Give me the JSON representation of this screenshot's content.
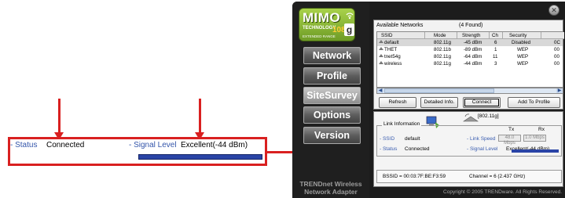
{
  "callout": {
    "status_label": "- Status",
    "status_value": "Connected",
    "signal_label": "- Signal Level",
    "signal_value": "Excellent(-44 dBm)",
    "signal_bar_fill": 1.0
  },
  "sidebar": {
    "logo_brand": "MIMO",
    "logo_sub": "TECHNOLOGY",
    "logo_range": "EXTENDED RANGE",
    "logo_speed": "108",
    "logo_band": "g",
    "items": [
      {
        "label": "Network"
      },
      {
        "label": "Profile"
      },
      {
        "label": "SiteSurvey"
      },
      {
        "label": "Options"
      },
      {
        "label": "Version"
      }
    ],
    "footer_line1": "TRENDnet Wireless",
    "footer_line2": "Network Adapter"
  },
  "survey": {
    "title": "Available Networks",
    "count": "(4 Found)",
    "columns": [
      "SSID",
      "Mode",
      "Strength",
      "Ch",
      "Security",
      ""
    ],
    "rows": [
      {
        "ssid": "default",
        "mode": "802.11g",
        "strength": "-45 dBm",
        "ch": "6",
        "security": "Disabled",
        "extra": "0C"
      },
      {
        "ssid": "THET",
        "mode": "802.11b",
        "strength": "-89 dBm",
        "ch": "1",
        "security": "WEP",
        "extra": "00"
      },
      {
        "ssid": "tnet54g",
        "mode": "802.11g",
        "strength": "-64 dBm",
        "ch": "11",
        "security": "WEP",
        "extra": "00"
      },
      {
        "ssid": "wireless",
        "mode": "802.11g",
        "strength": "-44 dBm",
        "ch": "3",
        "security": "WEP",
        "extra": "00"
      }
    ],
    "buttons": {
      "refresh": "Refresh",
      "detailed": "Detailed Info.",
      "connect": "Connect",
      "add_profile": "Add To Profile"
    }
  },
  "link_info": {
    "mode_badge": "[802.11g]",
    "title": "Link Information",
    "ssid_label": "- SSID",
    "ssid_value": "default",
    "status_label": "- Status",
    "status_value": "Connected",
    "link_speed_label": "- Link Speed",
    "tx_header": "Tx",
    "rx_header": "Rx",
    "tx_value": "48.0 Mbps",
    "rx_value": "1.0 Mbps",
    "signal_label": "- Signal Level",
    "signal_value": "Excellent(-44 dBm)",
    "bssid": "BSSID = 00:03:7F:BE:F3:59",
    "channel": "Channel = 6 (2.437 GHz)"
  },
  "copyright": "Copyright © 2005 TRENDware. All Rights Reserved.",
  "colors": {
    "accent_red": "#d92020",
    "signal_blue": "#2a44a6",
    "label_blue": "#3355aa",
    "logo_green": "#8ab83a"
  }
}
